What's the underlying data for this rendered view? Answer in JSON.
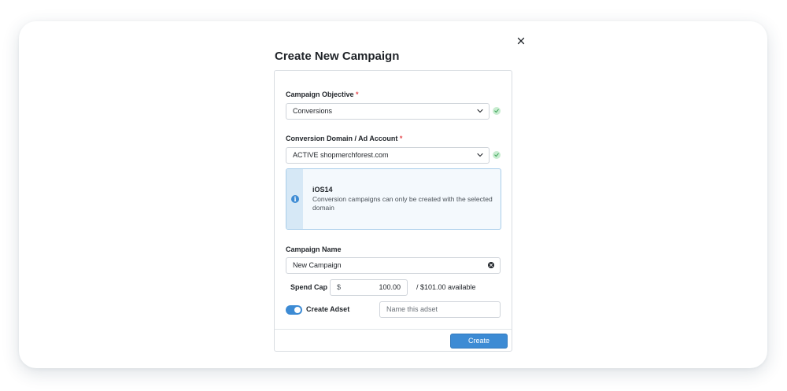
{
  "dialog": {
    "title": "Create New Campaign"
  },
  "form": {
    "objective": {
      "label": "Campaign Objective",
      "required_mark": "*",
      "value": "Conversions"
    },
    "domain": {
      "label": "Conversion Domain / Ad Account",
      "required_mark": "*",
      "value": "ACTIVE shopmerchforest.com"
    },
    "notice": {
      "title": "iOS14",
      "body": "Conversion campaigns can only be created with the selected domain"
    },
    "campaign_name": {
      "label": "Campaign Name",
      "value": "New Campaign"
    },
    "spend_cap": {
      "label": "Spend Cap",
      "currency": "$",
      "value": "100.00",
      "available": "/ $101.00 available"
    },
    "adset": {
      "label": "Create Adset",
      "enabled": true,
      "placeholder": "Name this adset"
    }
  },
  "footer": {
    "create_label": "Create"
  },
  "colors": {
    "accent": "#3d8bd4",
    "required": "#e5484d",
    "success_bg": "#c8ecd0",
    "success": "#3fa65a",
    "notice_bg": "#f4f9fd"
  }
}
